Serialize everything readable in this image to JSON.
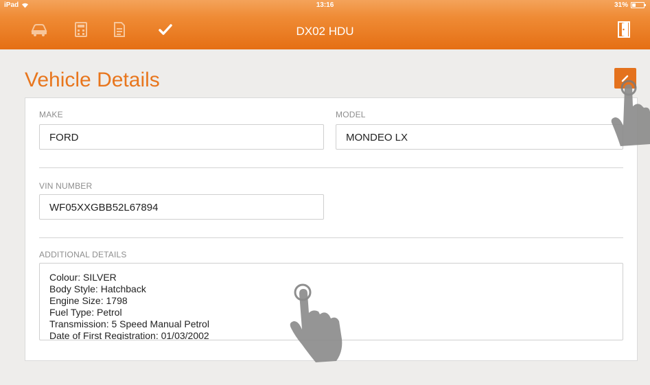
{
  "status_bar": {
    "device": "iPad",
    "time": "13:16",
    "battery": "31%",
    "battery_level": 0.31
  },
  "nav_bar": {
    "title": "DX02 HDU",
    "icons": [
      "car-icon",
      "calculator-icon",
      "document-icon",
      "checkmark-icon",
      "exit-door-icon"
    ]
  },
  "page": {
    "title": "Vehicle Details"
  },
  "fields": {
    "make": {
      "label": "MAKE",
      "value": "FORD"
    },
    "model": {
      "label": "MODEL",
      "value": "MONDEO LX"
    },
    "vin": {
      "label": "VIN NUMBER",
      "value": "WF05XXGBB52L67894"
    },
    "additional": {
      "label": "ADDITIONAL DETAILS",
      "lines": [
        "Colour: SILVER",
        "Body Style: Hatchback",
        "Engine Size: 1798",
        "Fuel Type: Petrol",
        "Transmission: 5 Speed Manual Petrol",
        "Date of First Registration: 01/03/2002"
      ]
    }
  },
  "colors": {
    "accent": "#e8761d",
    "navbar": "#ef8b35"
  }
}
